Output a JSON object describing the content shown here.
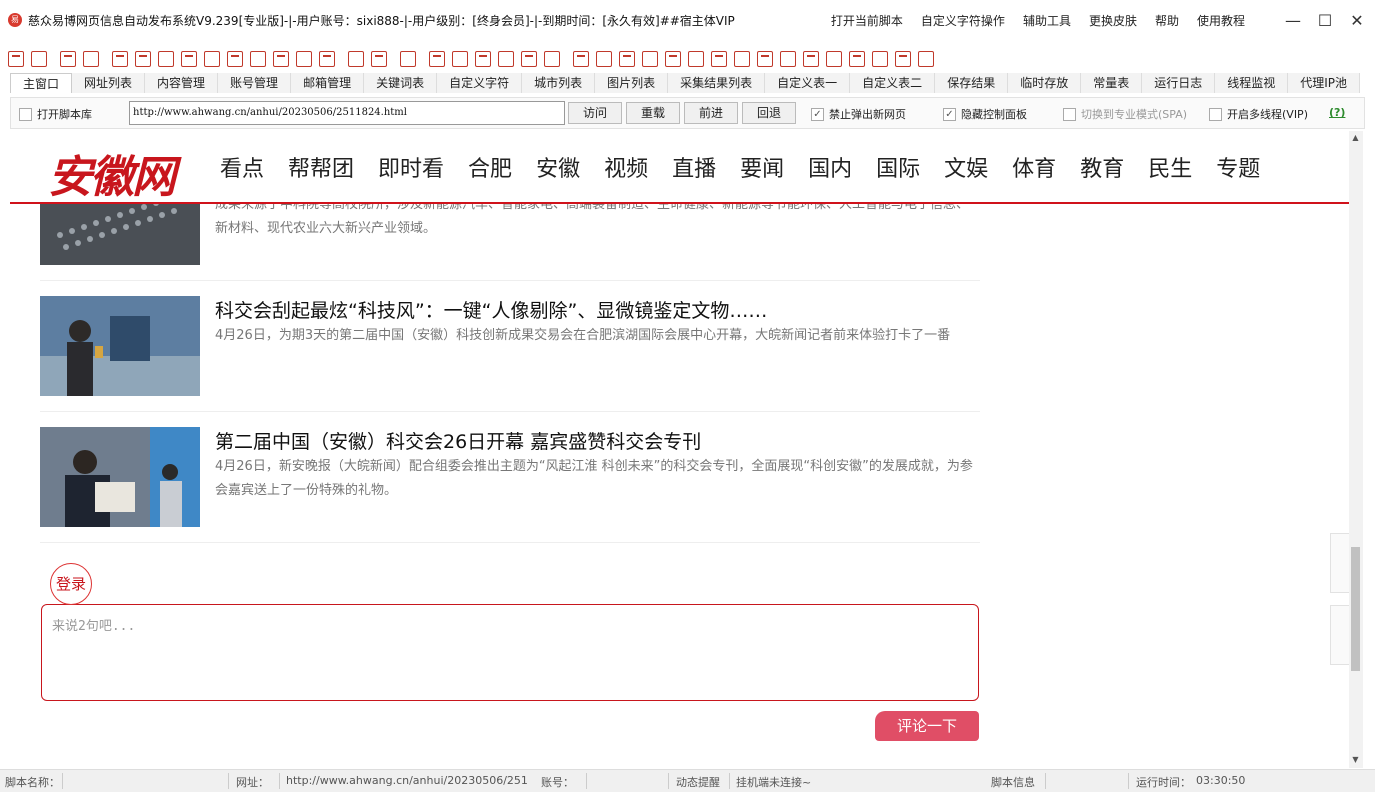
{
  "window": {
    "title": "慈众易博网页信息自动发布系统V9.239[专业版]-|-用户账号：sixi888-|-用户级别：[终身会员]-|-到期时间：[永久有效]##宿主体VIP",
    "menu": [
      "打开当前脚本",
      "自定义字符操作",
      "辅助工具",
      "更换皮肤",
      "帮助",
      "使用教程"
    ],
    "controls": [
      "minimize",
      "maximize",
      "close"
    ]
  },
  "tabs": [
    "主窗口",
    "网址列表",
    "内容管理",
    "账号管理",
    "邮箱管理",
    "关键词表",
    "自定义字符",
    "城市列表",
    "图片列表",
    "采集结果列表",
    "自定义表一",
    "自定义表二",
    "保存结果",
    "临时存放",
    "常量表",
    "运行日志",
    "线程监视",
    "代理IP池"
  ],
  "browser": {
    "open_lib_label": "打开脚本库",
    "url": "http://www.ahwang.cn/anhui/20230506/2511824.html",
    "buttons": [
      "访问",
      "重载",
      "前进",
      "回退"
    ],
    "checks": [
      {
        "label": "禁止弹出新网页",
        "checked": true
      },
      {
        "label": "隐藏控制面板",
        "checked": true
      },
      {
        "label": "切换到专业模式(SPA)",
        "checked": false
      },
      {
        "label": "开启多线程(VIP)",
        "checked": false
      }
    ],
    "help": "(?)"
  },
  "site": {
    "logo": "安徽网",
    "nav": [
      "看点",
      "帮帮团",
      "即时看",
      "合肥",
      "安徽",
      "视频",
      "直播",
      "要闻",
      "国内",
      "国际",
      "文娱",
      "体育",
      "教育",
      "民生",
      "专题"
    ]
  },
  "articles": [
    {
      "title": "",
      "summary": "成果来源于中科院等高校院所，涉及新能源汽车、智能家电、高端装备制造、生命健康、新能源等节能环保、人工智能与电子信息、新材料、现代农业六大新兴产业领域。"
    },
    {
      "title": "科交会刮起最炫“科技风”：一键“人像剔除”、显微镜鉴定文物……",
      "summary": "4月26日，为期3天的第二届中国（安徽）科技创新成果交易会在合肥滨湖国际会展中心开幕，大皖新闻记者前来体验打卡了一番"
    },
    {
      "title": "第二届中国（安徽）科交会26日开幕 嘉宾盛赞科交会专刊",
      "summary": "4月26日，新安晚报（大皖新闻）配合组委会推出主题为“风起江淮 科创未来”的科交会专刊，全面展现“科创安徽”的发展成就，为参会嘉宾送上了一份特殊的礼物。"
    }
  ],
  "comment": {
    "login": "登录",
    "placeholder": "来说2句吧...",
    "submit": "评论一下"
  },
  "status": {
    "script_label": "脚本名称：",
    "url_label": "网址：",
    "url_value": "http://www.ahwang.cn/anhui/20230506/251",
    "account_label": "账号：",
    "dynamic_label": "动态提醒",
    "dynamic_value": "挂机端未连接~",
    "info_label": "脚本信息",
    "runtime_label": "运行时间：",
    "runtime_value": "03:30:50"
  }
}
